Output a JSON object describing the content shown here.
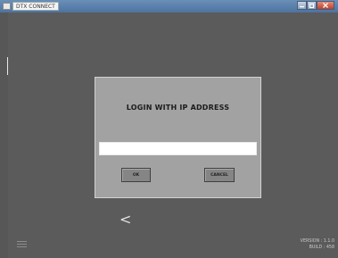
{
  "window": {
    "title": "DTX CONNECT",
    "controls": {
      "minimize_icon": "minimize-icon",
      "maximize_icon": "maximize-icon",
      "close_icon": "close-icon"
    }
  },
  "dialog": {
    "title": "LOGIN WITH IP ADDRESS",
    "ip_value": "",
    "ok_label": "OK",
    "cancel_label": "CANCEL"
  },
  "nav": {
    "back_icon": "chevron-left-icon",
    "back_glyph": "<",
    "menu_icon": "hamburger-menu-icon"
  },
  "footer": {
    "version": "VERSION : 1.1.0",
    "build": "BUILD : 458"
  },
  "colors": {
    "background": "#5b5b5b",
    "dialog_background": "#a2a2a2",
    "button_background": "#858585",
    "titlebar": "#5a80ad",
    "close_button": "#c0412b"
  }
}
